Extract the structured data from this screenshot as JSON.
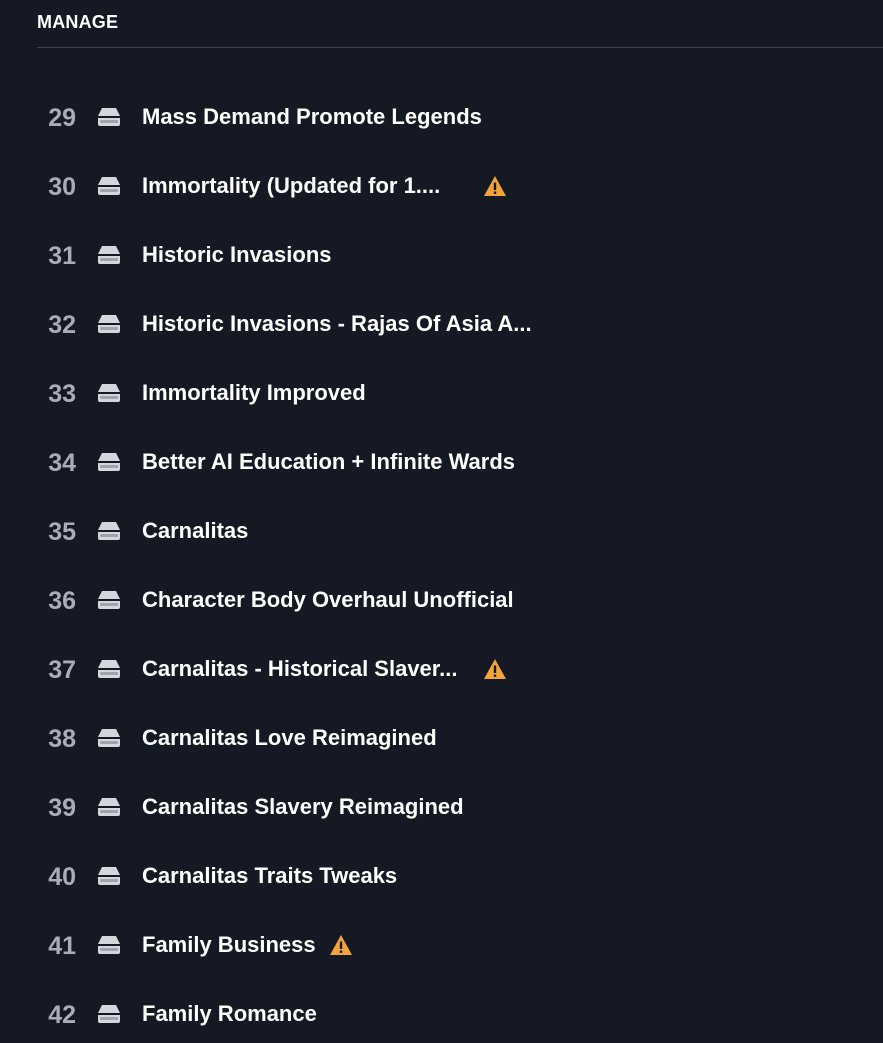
{
  "header": {
    "title": "MANAGE"
  },
  "mods": [
    {
      "index": "29",
      "name": "Mass Demand Promote Legends",
      "warning": false
    },
    {
      "index": "30",
      "name": "Immortality (Updated for 1....",
      "warning": true
    },
    {
      "index": "31",
      "name": "Historic Invasions",
      "warning": false
    },
    {
      "index": "32",
      "name": "Historic Invasions - Rajas Of Asia A...",
      "warning": false
    },
    {
      "index": "33",
      "name": "Immortality Improved",
      "warning": false
    },
    {
      "index": "34",
      "name": "Better AI Education + Infinite Wards",
      "warning": false
    },
    {
      "index": "35",
      "name": "Carnalitas",
      "warning": false
    },
    {
      "index": "36",
      "name": "Character Body Overhaul Unofficial",
      "warning": false
    },
    {
      "index": "37",
      "name": "Carnalitas - Historical Slaver...",
      "warning": true
    },
    {
      "index": "38",
      "name": "Carnalitas Love Reimagined",
      "warning": false
    },
    {
      "index": "39",
      "name": "Carnalitas Slavery Reimagined",
      "warning": false
    },
    {
      "index": "40",
      "name": "Carnalitas Traits Tweaks",
      "warning": false
    },
    {
      "index": "41",
      "name": "Family Business",
      "warning": true
    },
    {
      "index": "42",
      "name": "Family Romance",
      "warning": false
    }
  ],
  "icons": {
    "row_icon": "drive-icon",
    "warning_icon": "warning-icon"
  },
  "colors": {
    "background": "#141923",
    "warning": "#f2a33a"
  }
}
